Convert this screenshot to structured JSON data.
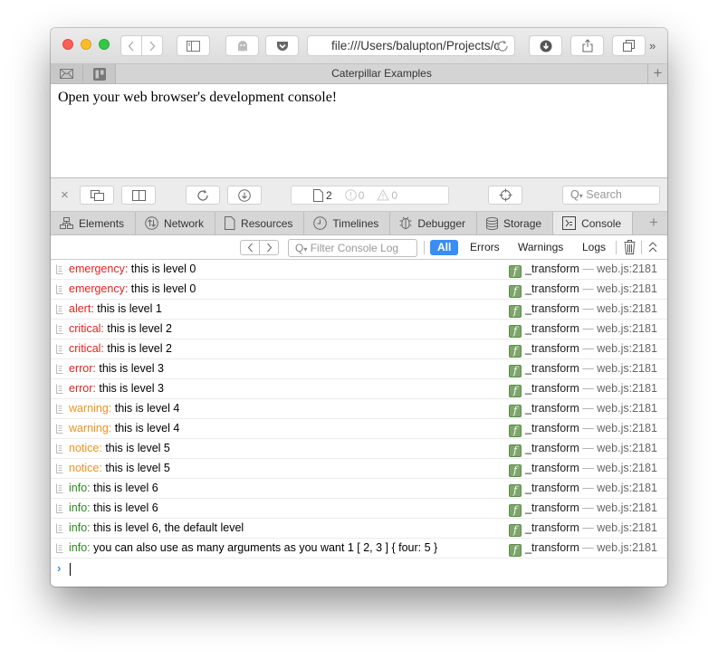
{
  "browser": {
    "url": "file:///Users/balupton/Projects/c",
    "tab_title": "Caterpillar Examples",
    "more": "»"
  },
  "page": {
    "text": "Open your web browser's development console!"
  },
  "devtools": {
    "close": "×",
    "resources_count": "2",
    "error_count": "0",
    "warning_count": "0",
    "search_placeholder": "Search",
    "tabs": [
      {
        "label": "Elements",
        "icon": "elements-icon"
      },
      {
        "label": "Network",
        "icon": "network-icon"
      },
      {
        "label": "Resources",
        "icon": "resources-icon"
      },
      {
        "label": "Timelines",
        "icon": "timelines-icon"
      },
      {
        "label": "Debugger",
        "icon": "debugger-icon"
      },
      {
        "label": "Storage",
        "icon": "storage-icon"
      },
      {
        "label": "Console",
        "icon": "console-icon",
        "active": true
      }
    ],
    "add_tab": "+"
  },
  "console": {
    "filter_placeholder": "Filter Console Log",
    "filters": {
      "all": "All",
      "errors": "Errors",
      "warnings": "Warnings",
      "logs": "Logs"
    },
    "colors": {
      "red": "#e0261d",
      "orange": "#f0931f",
      "green": "#2a8a1e",
      "prompt": "#3b8cf0",
      "active_filter": "#3a8ef3"
    },
    "entries": [
      {
        "level": "emergency:",
        "text": " this is level 0",
        "color": "red",
        "source_fn": "_transform",
        "source_file": "web.js:2181"
      },
      {
        "level": "emergency:",
        "text": " this is level 0",
        "color": "red",
        "source_fn": "_transform",
        "source_file": "web.js:2181"
      },
      {
        "level": "alert:",
        "text": " this is level 1",
        "color": "red",
        "source_fn": "_transform",
        "source_file": "web.js:2181"
      },
      {
        "level": "critical:",
        "text": " this is level 2",
        "color": "red",
        "source_fn": "_transform",
        "source_file": "web.js:2181"
      },
      {
        "level": "critical:",
        "text": " this is level 2",
        "color": "red",
        "source_fn": "_transform",
        "source_file": "web.js:2181"
      },
      {
        "level": "error:",
        "text": " this is level 3",
        "color": "red",
        "source_fn": "_transform",
        "source_file": "web.js:2181"
      },
      {
        "level": "error:",
        "text": " this is level 3",
        "color": "red",
        "source_fn": "_transform",
        "source_file": "web.js:2181"
      },
      {
        "level": "warning:",
        "text": " this is level 4",
        "color": "orange",
        "source_fn": "_transform",
        "source_file": "web.js:2181"
      },
      {
        "level": "warning:",
        "text": " this is level 4",
        "color": "orange",
        "source_fn": "_transform",
        "source_file": "web.js:2181"
      },
      {
        "level": "notice:",
        "text": " this is level 5",
        "color": "orange",
        "source_fn": "_transform",
        "source_file": "web.js:2181"
      },
      {
        "level": "notice:",
        "text": " this is level 5",
        "color": "orange",
        "source_fn": "_transform",
        "source_file": "web.js:2181"
      },
      {
        "level": "info:",
        "text": " this is level 6",
        "color": "green",
        "source_fn": "_transform",
        "source_file": "web.js:2181"
      },
      {
        "level": "info:",
        "text": " this is level 6",
        "color": "green",
        "source_fn": "_transform",
        "source_file": "web.js:2181"
      },
      {
        "level": "info:",
        "text": " this is level 6, the default level",
        "color": "green",
        "source_fn": "_transform",
        "source_file": "web.js:2181"
      },
      {
        "level": "info:",
        "text": " you can also use as many arguments as you want 1 [ 2, 3 ] { four: 5 }",
        "color": "green",
        "source_fn": "_transform",
        "source_file": "web.js:2181"
      }
    ],
    "source_separator": " — ",
    "prompt": "›"
  }
}
